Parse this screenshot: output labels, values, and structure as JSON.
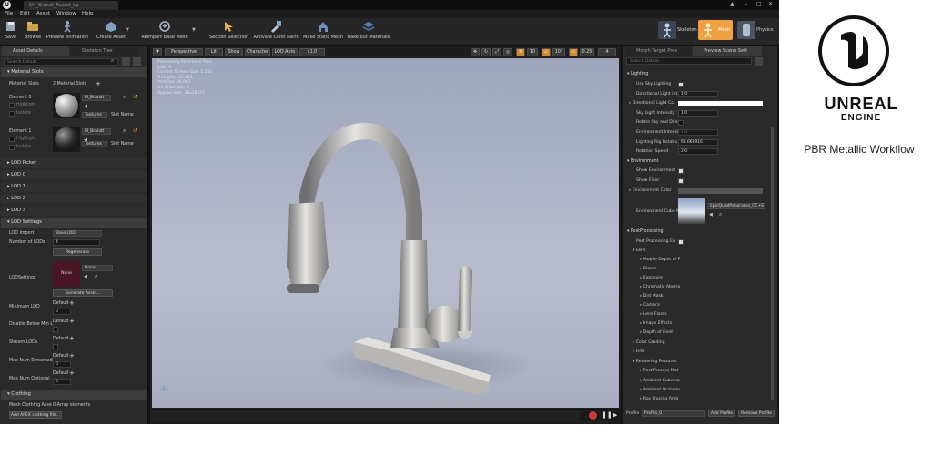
{
  "titlebar": {
    "tab_title": "SM_Brandt_Faucet_Lg",
    "logo": "U"
  },
  "menubar": {
    "items": [
      "File",
      "Edit",
      "Asset",
      "Window",
      "Help"
    ]
  },
  "toolbar": {
    "buttons": [
      {
        "label": "Save",
        "icon": "save-icon"
      },
      {
        "label": "Browse",
        "icon": "browse-icon"
      },
      {
        "label": "Preview Animation",
        "icon": "preview-animation-icon"
      },
      {
        "label": "Create Asset",
        "icon": "create-asset-icon"
      },
      {
        "label": "Reimport Base Mesh",
        "icon": "reimport-icon"
      },
      {
        "label": "Section Selection",
        "icon": "section-selection-icon"
      },
      {
        "label": "Activate Cloth Paint",
        "icon": "cloth-paint-icon"
      },
      {
        "label": "Make Static Mesh",
        "icon": "static-mesh-icon"
      },
      {
        "label": "Bake out Materials",
        "icon": "bake-materials-icon"
      }
    ],
    "modes": [
      "Skeleton",
      "Mesh",
      "Physics"
    ],
    "active_mode": "Mesh",
    "accent": "#f0a040"
  },
  "left_panel": {
    "tabs": [
      "Asset Details",
      "Skeleton Tree"
    ],
    "search_placeholder": "Search Details",
    "material_slots": {
      "header": "Material Slots",
      "label": "Material Slots",
      "count_text": "2 Material Slots",
      "elements": [
        {
          "name": "Element 0",
          "material": "M_Brandt",
          "mode": "Textures",
          "slot": "Slot Name",
          "highlight": "Highlight",
          "isolate": "Isolate"
        },
        {
          "name": "Element 1",
          "material": "M_Brandt",
          "mode": "Textures",
          "slot": "Slot Name",
          "highlight": "Highlight",
          "isolate": "Isolate"
        }
      ]
    },
    "lod_sections": [
      "LOD Picker",
      "LOD 0",
      "LOD 1",
      "LOD 2",
      "LOD 3"
    ],
    "lod_settings": {
      "header": "LOD Settings",
      "lod_import_label": "LOD Import",
      "lod_import_value": "Base LOD",
      "num_lods_label": "Number of LODs",
      "num_lods_value": "4",
      "regenerate": "Regenerate",
      "lod_settings_label": "LODSettings",
      "thumbnail_text": "None",
      "none_value": "None",
      "generate_asset": "Generate Asset...",
      "min_lod_label": "Minimum LOD",
      "default_text": "Default",
      "min_lod_value": "0",
      "disable_below_label": "Disable Below Min L",
      "stream_lods_label": "Stream LODs",
      "max_streamed_label": "Max Num Streamed",
      "max_streamed_value": "0",
      "max_optional_label": "Max Num Optional",
      "max_optional_value": "0"
    },
    "clothing": {
      "header": "Clothing",
      "mesh_clothing_label": "Mesh Clothing Asse",
      "mesh_clothing_value": "0 Array elements",
      "add_apex": "Add APEX clothing file..."
    }
  },
  "viewport": {
    "buttons": [
      "Perspective",
      "Lit",
      "Show",
      "Character",
      "LOD Auto",
      "x1.0"
    ],
    "stats": [
      "Previewing Reference Pose",
      "LOD: 0",
      "Current Screen Size: 1.522",
      "Triangles: 42,422",
      "Vertices: 36,063",
      "UV Channels: 2",
      "Approx Size: 38x28x51"
    ],
    "snap_value": "10",
    "rot_value": "10°",
    "scale_value": "0.25",
    "cam_speed": "4"
  },
  "right_panel": {
    "tabs": [
      "Morph Target Prev",
      "Preview Scene Sett"
    ],
    "search_placeholder": "Search Details",
    "lighting_header": "Lighting",
    "props": [
      {
        "label": "Use Sky Lighting",
        "type": "check",
        "value": true
      },
      {
        "label": "Directional Light Int",
        "type": "num",
        "value": "1.0"
      },
      {
        "label": "Directional Light Co",
        "type": "color",
        "value": ""
      },
      {
        "label": "Sky Light Intensity",
        "type": "num",
        "value": "1.0"
      },
      {
        "label": "Rotate Sky and Dire",
        "type": "check",
        "value": false
      },
      {
        "label": "Environment Intensi",
        "type": "num",
        "value": "1.0"
      },
      {
        "label": "Lighting Rig Rotatio",
        "type": "num",
        "value": "63.668916"
      },
      {
        "label": "Rotation Speed",
        "type": "num",
        "value": "2.0"
      }
    ],
    "environment_header": "Environment",
    "env_props": [
      {
        "label": "Show Environment",
        "value": true
      },
      {
        "label": "Show Floor",
        "value": true
      }
    ],
    "env_color_label": "Environment Color",
    "cube_label": "Environment Cube M",
    "cube_value": "EpicQuadPanorama_CC+E",
    "postprocessing_header": "PostProcessing",
    "pp_enabled_label": "Post Processing En",
    "lens_header": "Lens",
    "lens_items": [
      "Mobile Depth of F",
      "Bloom",
      "Exposure",
      "Chromatic Aberra",
      "Dirt Mask",
      "Camera",
      "Lens Flares",
      "Image Effects",
      "Depth of Field"
    ],
    "other_items": [
      "Color Grading",
      "Film"
    ],
    "rendering_header": "Rendering Features",
    "rendering_items": [
      "Post Process Mat",
      "Ambient Cubema",
      "Ambient Occlusio",
      "Ray Tracing Amb"
    ],
    "profile_label": "Profile",
    "profile_value": "Profile_0",
    "add_profile": "Add Profile",
    "remove_profile": "Remove Profile"
  },
  "branding": {
    "wordmark_line1": "UNREAL",
    "wordmark_line2": "ENGINE",
    "subtitle": "PBR Metallic Workflow"
  }
}
